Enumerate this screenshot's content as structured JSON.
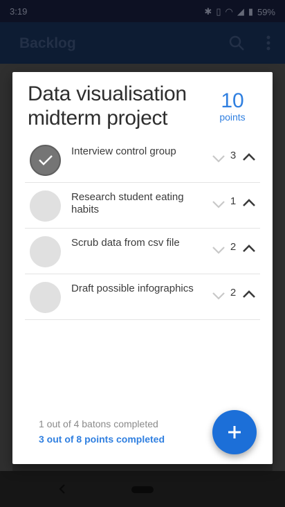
{
  "status_bar": {
    "time": "3:19",
    "battery": "59%"
  },
  "app_bar": {
    "title": "Backlog"
  },
  "dialog": {
    "title": "Data visualisation midterm project",
    "points_value": "10",
    "points_label": "points",
    "tasks": [
      {
        "label": "Interview control group",
        "points": "3",
        "completed": true
      },
      {
        "label": "Research student eating habits",
        "points": "1",
        "completed": false
      },
      {
        "label": "Scrub data from csv file",
        "points": "2",
        "completed": false
      },
      {
        "label": "Draft possible infographics",
        "points": "2",
        "completed": false
      }
    ],
    "summary_batons": "1 out of 4 batons completed",
    "summary_points": "3 out of 8 points completed",
    "fab_icon": "plus-icon"
  },
  "colors": {
    "accent": "#2f7fe0",
    "fab": "#1c6fd8",
    "app_bar": "#10233f"
  }
}
